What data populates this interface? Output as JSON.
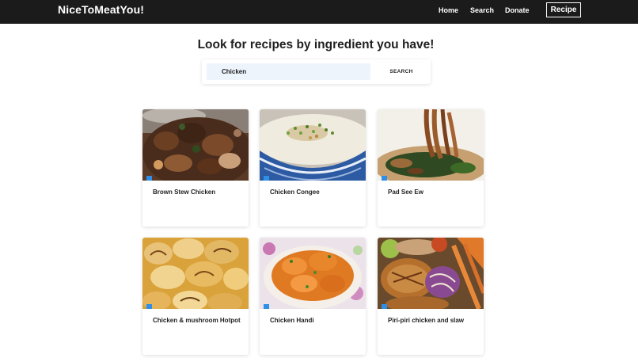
{
  "navbar": {
    "brand": "NiceToMeatYou!",
    "links": [
      {
        "label": "Home"
      },
      {
        "label": "Search"
      },
      {
        "label": "Donate"
      }
    ],
    "recipe_button": "Recipe"
  },
  "main": {
    "headline": "Look for recipes by ingredient you have!",
    "search": {
      "value": "Chicken",
      "button_label": "SEARCH"
    },
    "recipes": [
      {
        "title": "Brown Stew Chicken"
      },
      {
        "title": "Chicken Congee"
      },
      {
        "title": "Pad See Ew"
      },
      {
        "title": "Chicken & mushroom Hotpot"
      },
      {
        "title": "Chicken Handi"
      },
      {
        "title": "Piri-piri chicken and slaw"
      }
    ]
  },
  "colors": {
    "navbar_bg": "#1b1b1b",
    "input_bg": "#eef4fc",
    "accent_marker": "#2f8fe6"
  }
}
